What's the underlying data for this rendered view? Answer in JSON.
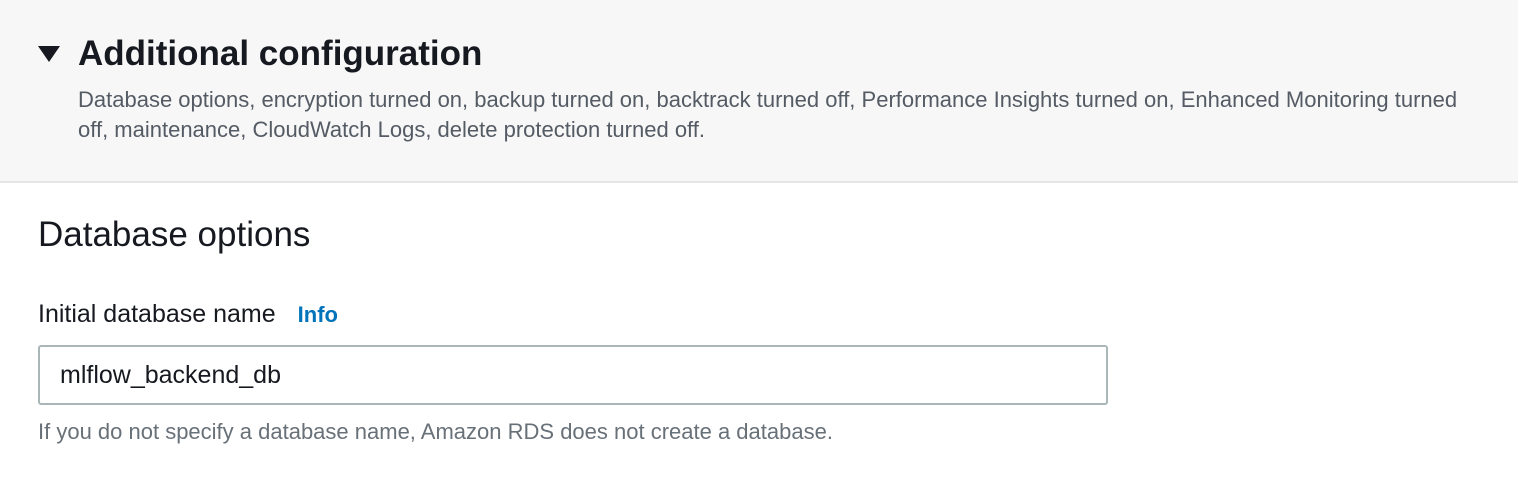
{
  "additional_config": {
    "title": "Additional configuration",
    "expanded": true,
    "description": "Database options, encryption turned on, backup turned on, backtrack turned off, Performance Insights turned on, Enhanced Monitoring turned off, maintenance, CloudWatch Logs, delete protection turned off.",
    "caret_icon": "caret-down-icon"
  },
  "database_options": {
    "title": "Database options",
    "initial_db_name": {
      "label": "Initial database name",
      "info_label": "Info",
      "value": "mlflow_backend_db",
      "hint": "If you do not specify a database name, Amazon RDS does not create a database."
    }
  },
  "colors": {
    "header_bg": "#f7f7f7",
    "link": "#0073bb",
    "text": "#16191f",
    "secondary_text": "#545b64"
  }
}
